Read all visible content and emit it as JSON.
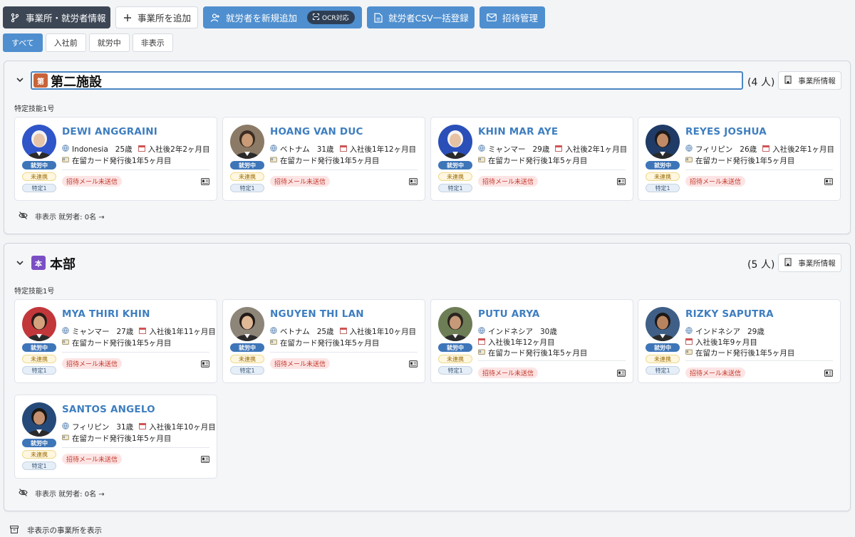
{
  "toolbar": {
    "office_info": "事業所・就労者情報",
    "add_office": "事業所を追加",
    "add_worker": "就労者を新規追加",
    "ocr": "OCR対応",
    "csv_import": "就労者CSV一括登録",
    "invite": "招待管理"
  },
  "filters": [
    {
      "label": "すべて",
      "active": true
    },
    {
      "label": "入社前",
      "active": false
    },
    {
      "label": "就労中",
      "active": false
    },
    {
      "label": "非表示",
      "active": false
    }
  ],
  "offices": [
    {
      "badge": "第",
      "badge_color": "#c8643a",
      "name": "第二施設",
      "count": "(4 人)",
      "info_label": "事業所情報",
      "visa_group": "特定技能1号",
      "hidden_label": "非表示 就労者: 0名 →",
      "workers": [
        {
          "name": "DEWI ANGGRAINI",
          "nationality": "Indonesia",
          "age": "25歳",
          "tenure": "入社後2年2ヶ月目",
          "residence": "在留カード発行後1年5ヶ月目",
          "status": "就労中",
          "contact": "未連携",
          "visa": "特定1",
          "mail": "招待メール未送信",
          "avatar_bg": "#2f55c9",
          "avatar_skin": "#e8c4a8",
          "avatar_hair": "#f2f2f2"
        },
        {
          "name": "HOANG VAN DUC",
          "nationality": "ベトナム",
          "age": "31歳",
          "tenure": "入社後1年12ヶ月目",
          "residence": "在留カード発行後1年5ヶ月目",
          "status": "就労中",
          "contact": "未連携",
          "visa": "特定1",
          "mail": "招待メール未送信",
          "avatar_bg": "#8b7a66",
          "avatar_skin": "#c99b76",
          "avatar_hair": "#3a2c22"
        },
        {
          "name": "KHIN MAR AYE",
          "nationality": "ミャンマー",
          "age": "29歳",
          "tenure": "入社後2年1ヶ月目",
          "residence": "在留カード発行後1年5ヶ月目",
          "status": "就労中",
          "contact": "未連携",
          "visa": "特定1",
          "mail": "招待メール未送信",
          "avatar_bg": "#2a4fb8",
          "avatar_skin": "#e6c1a3",
          "avatar_hair": "#f4f4f4"
        },
        {
          "name": "REYES JOSHUA",
          "nationality": "フィリピン",
          "age": "26歳",
          "tenure": "入社後2年1ヶ月目",
          "residence": "在留カード発行後1年5ヶ月目",
          "status": "就労中",
          "contact": "未連携",
          "visa": "特定1",
          "mail": "招待メール未送信",
          "avatar_bg": "#1f3b66",
          "avatar_skin": "#c08a66",
          "avatar_hair": "#1d1a18"
        }
      ]
    },
    {
      "badge": "本",
      "badge_color": "#7b4fc4",
      "name": "本部",
      "count": "(5 人)",
      "info_label": "事業所情報",
      "visa_group": "特定技能1号",
      "hidden_label": "非表示 就労者: 0名 →",
      "workers": [
        {
          "name": "MYA THIRI KHIN",
          "nationality": "ミャンマー",
          "age": "27歳",
          "tenure": "入社後1年11ヶ月目",
          "residence": "在留カード発行後1年5ヶ月目",
          "status": "就労中",
          "contact": "未連携",
          "visa": "特定1",
          "mail": "招待メール未送信",
          "avatar_bg": "#c2373a",
          "avatar_skin": "#d6a27e",
          "avatar_hair": "#2a1c18"
        },
        {
          "name": "NGUYEN THI LAN",
          "nationality": "ベトナム",
          "age": "25歳",
          "tenure": "入社後1年10ヶ月目",
          "residence": "在留カード発行後1年5ヶ月目",
          "status": "就労中",
          "contact": "未連携",
          "visa": "特定1",
          "mail": "招待メール未送信",
          "avatar_bg": "#8c8578",
          "avatar_skin": "#e0b896",
          "avatar_hair": "#221a16"
        },
        {
          "name": "PUTU ARYA",
          "nationality": "インドネシア",
          "age": "30歳",
          "tenure": "入社後1年12ヶ月目",
          "residence": "在留カード発行後1年5ヶ月目",
          "status": "就労中",
          "contact": "未連携",
          "visa": "特定1",
          "mail": "招待メール未送信",
          "avatar_bg": "#6d7d55",
          "avatar_skin": "#c69a78",
          "avatar_hair": "#2b2420"
        },
        {
          "name": "RIZKY SAPUTRA",
          "nationality": "インドネシア",
          "age": "29歳",
          "tenure": "入社後1年9ヶ月目",
          "residence": "在留カード発行後1年5ヶ月目",
          "status": "就労中",
          "contact": "未連携",
          "visa": "特定1",
          "mail": "招待メール未送信",
          "avatar_bg": "#3f5f86",
          "avatar_skin": "#b88460",
          "avatar_hair": "#1b1816"
        },
        {
          "name": "SANTOS ANGELO",
          "nationality": "フィリピン",
          "age": "31歳",
          "tenure": "入社後1年10ヶ月目",
          "residence": "在留カード発行後1年5ヶ月目",
          "status": "就労中",
          "contact": "未連携",
          "visa": "特定1",
          "mail": "招待メール未送信",
          "avatar_bg": "#254a7a",
          "avatar_skin": "#c49070",
          "avatar_hair": "#1a1714"
        }
      ]
    }
  ],
  "footer": {
    "show_hidden_offices": "非表示の事業所を表示"
  },
  "icons": {
    "branch": "branch-icon",
    "plus": "plus-icon",
    "add_user": "add-user-icon",
    "scan": "scan-icon",
    "file": "file-icon",
    "mail": "mail-icon",
    "chevron": "chevron-down-icon",
    "building": "building-icon",
    "globe": "globe-icon",
    "calendar": "calendar-icon",
    "card": "residence-card-icon",
    "idcard": "id-card-icon",
    "eye_off": "eye-off-icon",
    "archive": "archive-icon"
  }
}
